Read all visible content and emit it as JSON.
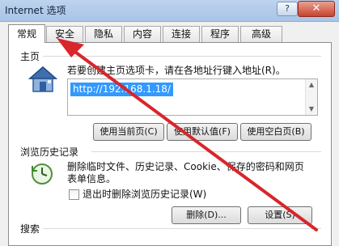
{
  "window": {
    "title": "Internet 选项",
    "help_label": "?",
    "close_label": "✕"
  },
  "tabs": [
    {
      "label": "常规",
      "active": true
    },
    {
      "label": "安全",
      "active": false
    },
    {
      "label": "隐私",
      "active": false
    },
    {
      "label": "内容",
      "active": false
    },
    {
      "label": "连接",
      "active": false
    },
    {
      "label": "程序",
      "active": false
    },
    {
      "label": "高级",
      "active": false
    }
  ],
  "home": {
    "section_label": "主页",
    "description": "若要创建主页选项卡，请在各地址行键入地址(R)。",
    "url_value": "http://192.168.1.18/",
    "buttons": {
      "use_current": "使用当前页(C)",
      "use_default": "使用默认值(F)",
      "use_blank": "使用空白页(B)"
    }
  },
  "history": {
    "section_label": "浏览历史记录",
    "description_line1": "删除临时文件、历史记录、Cookie、保存的密码和网页",
    "description_line2": "表单信息。",
    "checkbox_label": "退出时删除浏览历史记录(W)",
    "checkbox_checked": false,
    "buttons": {
      "delete": "删除(D)...",
      "settings": "设置(S)"
    }
  },
  "search": {
    "section_label": "搜索"
  },
  "annotation": {
    "arrow_color": "#d8262b"
  },
  "icons": [
    "home-icon",
    "history-clock-icon",
    "close-icon",
    "help-icon"
  ],
  "colors": {
    "selection": "#3399ff",
    "titlebar": "#b4cdec",
    "close_button": "#c7432d"
  }
}
